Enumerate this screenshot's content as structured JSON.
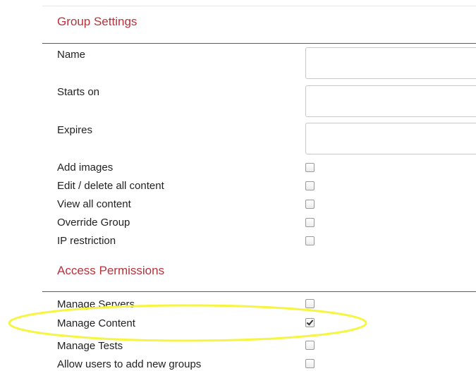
{
  "group_settings": {
    "title": "Group Settings",
    "fields": [
      {
        "label": "Name",
        "value": ""
      },
      {
        "label": "Starts on",
        "value": ""
      },
      {
        "label": "Expires",
        "value": ""
      }
    ],
    "checkboxes": [
      {
        "label": "Add images",
        "checked": false
      },
      {
        "label": "Edit / delete all content",
        "checked": false
      },
      {
        "label": "View all content",
        "checked": false
      },
      {
        "label": "Override Group",
        "checked": false
      },
      {
        "label": "IP restriction",
        "checked": false
      }
    ]
  },
  "access_permissions": {
    "title": "Access Permissions",
    "checkboxes": [
      {
        "label": "Manage Servers",
        "checked": false
      },
      {
        "label": "Manage Content",
        "checked": true
      },
      {
        "label": "Manage Tests",
        "checked": false
      },
      {
        "label": "Allow users to add new groups",
        "checked": false
      }
    ]
  },
  "annotation": {
    "highlight_color": "#f5f542"
  }
}
